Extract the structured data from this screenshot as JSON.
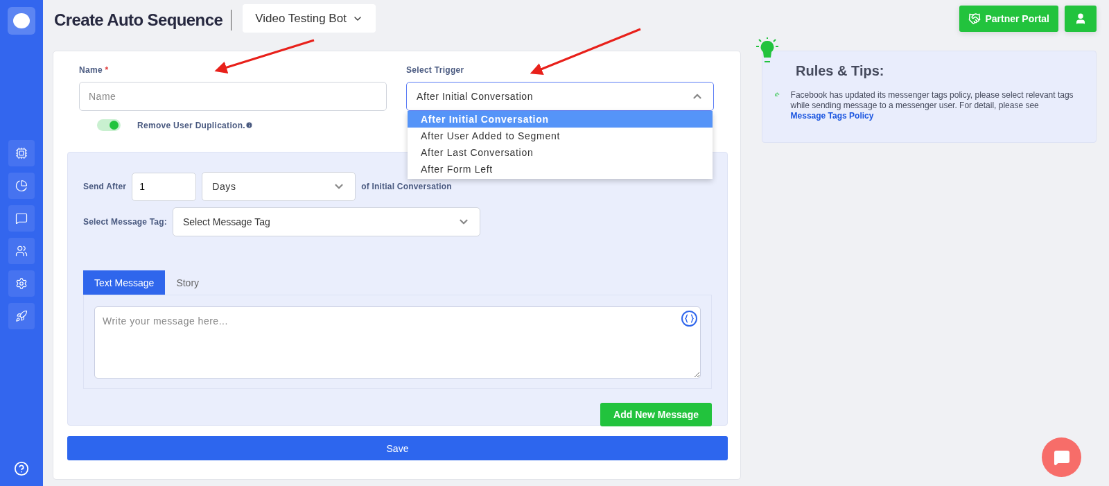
{
  "header": {
    "title": "Create Auto Sequence",
    "bot_selector": "Video Testing Bot",
    "partner_button": "Partner Portal"
  },
  "form": {
    "name_label": "Name",
    "required_mark": "*",
    "name_placeholder": "Name",
    "toggle": {
      "label": "Remove User Duplication.",
      "on": true
    },
    "trigger": {
      "label": "Select Trigger",
      "value": "After Initial Conversation",
      "expanded": true,
      "options": [
        {
          "label": "After Initial Conversation",
          "selected": true
        },
        {
          "label": "After User Added to Segment",
          "selected": false
        },
        {
          "label": "After Last Conversation",
          "selected": false
        },
        {
          "label": "After Form Left",
          "selected": false
        }
      ]
    }
  },
  "message": {
    "send_after_label": "Send After",
    "amount": "1",
    "unit": "Days",
    "suffix": "of Initial Conversation",
    "tag_label": "Select Message Tag:",
    "tag_value": "Select Message Tag",
    "tabs": [
      {
        "label": "Text Message",
        "selected": true
      },
      {
        "label": "Story",
        "selected": false
      }
    ],
    "textarea_placeholder": "Write your message here...",
    "add_button": "Add New Message"
  },
  "save_button": "Save",
  "tips": {
    "title": "Rules & Tips:",
    "text": "Facebook has updated its messenger tags policy, please select relevant tags while sending message to a messenger user. For detail, please see",
    "link": "Message Tags Policy"
  }
}
